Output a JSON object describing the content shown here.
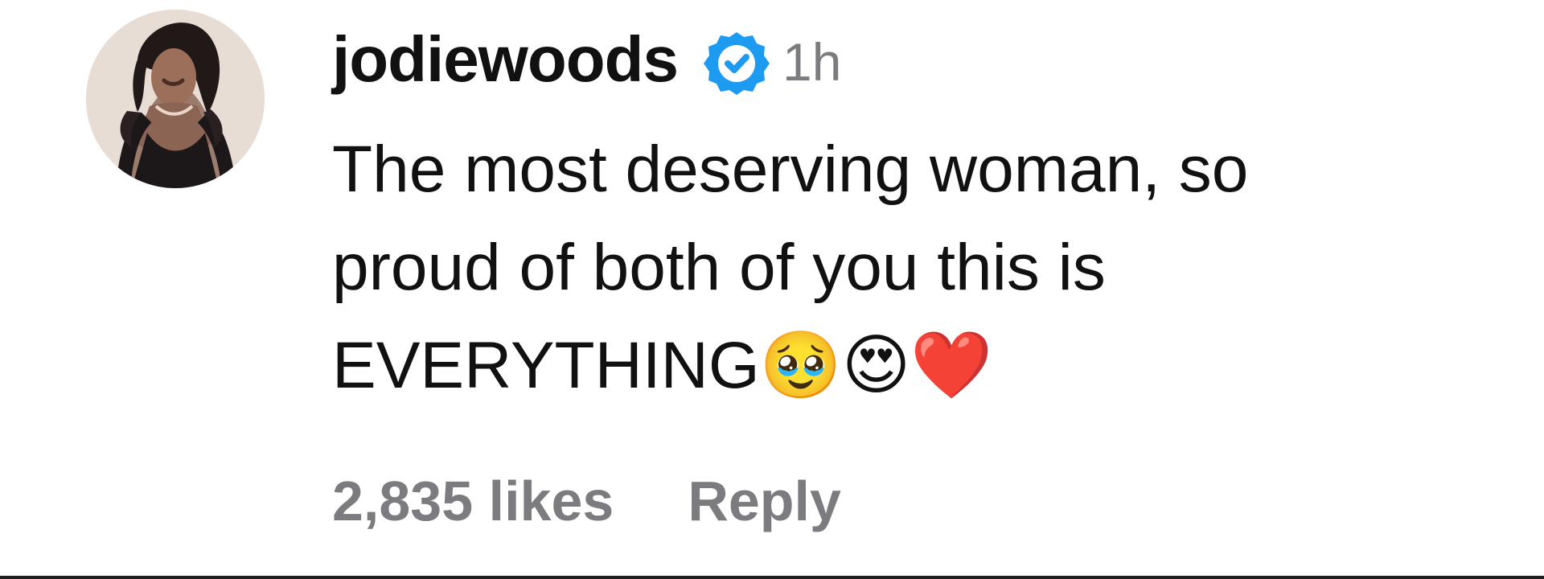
{
  "comment": {
    "username": "jodiewoods",
    "verified_icon": "verified-badge-icon",
    "timestamp": "1h",
    "text_line_1": "The most deserving woman, so",
    "text_line_2": "proud of both of you this is",
    "text_line_3": "EVERYTHING",
    "emojis": [
      "🥹",
      "😍",
      "❤️"
    ]
  },
  "footer": {
    "likes": "2,835 likes",
    "reply_label": "Reply"
  },
  "colors": {
    "primary_text": "#111111",
    "secondary_text": "#7b7b80",
    "verified_blue": "#1d9bf0"
  }
}
